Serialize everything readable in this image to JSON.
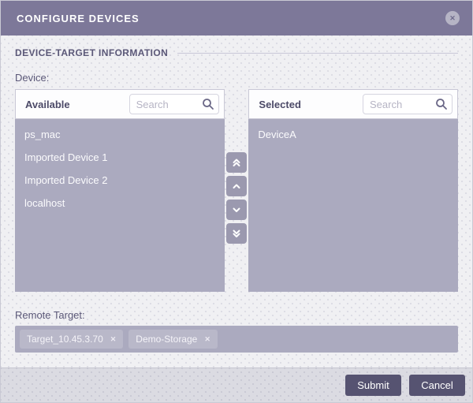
{
  "header": {
    "title": "CONFIGURE DEVICES"
  },
  "icons": {
    "close": "✕",
    "tag_remove": "✕",
    "search": "magnifier",
    "transfer": [
      "chevron-double-up",
      "chevron-up",
      "chevron-down",
      "chevron-double-down"
    ]
  },
  "section": {
    "title": "DEVICE-TARGET INFORMATION"
  },
  "labels": {
    "device": "Device:",
    "remote_target": "Remote Target:"
  },
  "available_panel": {
    "label": "Available",
    "search_placeholder": "Search",
    "search_value": "",
    "items": [
      "ps_mac",
      "Imported Device 1",
      "Imported Device 2",
      "localhost"
    ]
  },
  "selected_panel": {
    "label": "Selected",
    "search_placeholder": "Search",
    "search_value": "",
    "items": [
      "DeviceA"
    ]
  },
  "remote_targets": [
    {
      "label": "Target_10.45.3.70"
    },
    {
      "label": "Demo-Storage"
    }
  ],
  "footer": {
    "submit_label": "Submit",
    "cancel_label": "Cancel"
  },
  "colors": {
    "header_bg": "#7d7899",
    "list_bg": "#abaabf",
    "action_button_bg": "#565371",
    "tag_bg": "#b9b8c9",
    "body_bg": "#f0f0f3",
    "footer_bg": "#dbdbe2"
  }
}
